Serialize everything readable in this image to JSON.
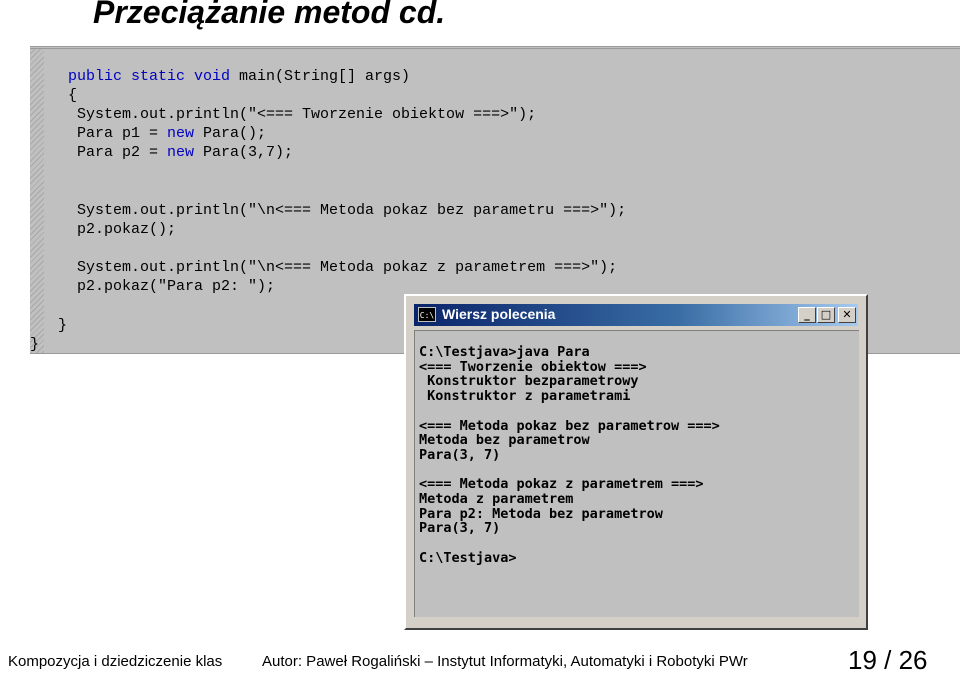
{
  "slide": {
    "title": "Przeciążanie metod cd."
  },
  "code": {
    "lines": [
      [
        {
          "t": "public static void",
          "k": true
        },
        {
          "t": " main(String[] args)",
          "k": false
        }
      ],
      [
        {
          "t": "{",
          "k": false
        }
      ],
      [
        {
          "t": " System.out.println(\"<=== Tworzenie obiektow ===>\");",
          "k": false
        }
      ],
      [
        {
          "t": " Para p1 = ",
          "k": false
        },
        {
          "t": "new",
          "k": true
        },
        {
          "t": " Para();",
          "k": false
        }
      ],
      [
        {
          "t": " Para p2 = ",
          "k": false
        },
        {
          "t": "new",
          "k": true
        },
        {
          "t": " Para(3,7);",
          "k": false
        }
      ],
      [],
      [
        {
          "t": " System.out.println(\"\\n<=== Metoda pokaz bez parametru ===>\");",
          "k": false
        }
      ],
      [
        {
          "t": " p2.pokaz();",
          "k": false
        }
      ],
      [
        {
          "t": " System.out.println(\"\\n<=== Metoda pokaz z parametrem ===>\");",
          "k": false
        }
      ],
      [
        {
          "t": " p2.pokaz(\"Para p2: \");",
          "k": false
        }
      ],
      [
        {
          "t": "}",
          "k": false
        }
      ],
      [
        {
          "t": "}",
          "k": false
        }
      ]
    ]
  },
  "console": {
    "title": "Wiersz polecenia",
    "icon_label": "C:\\",
    "minimize_glyph": "_",
    "maximize_glyph": "□",
    "close_glyph": "✕",
    "lines": [
      "C:\\Testjava>java Para",
      "<=== Tworzenie obiektow ===>",
      " Konstruktor bezparametrowy",
      " Konstruktor z parametrami",
      "",
      "<=== Metoda pokaz bez parametrow ===>",
      "Metoda bez parametrow",
      "Para(3, 7)",
      "",
      "<=== Metoda pokaz z parametrem ===>",
      "Metoda z parametrem",
      "Para p2: Metoda bez parametrow",
      "Para(3, 7)",
      "",
      "C:\\Testjava>"
    ]
  },
  "footer": {
    "left": "Kompozycja i dziedziczenie klas",
    "center": "Autor: Paweł Rogaliński – Instytut Informatyki, Automatyki i Robotyki PWr",
    "page": "19 / 26"
  }
}
